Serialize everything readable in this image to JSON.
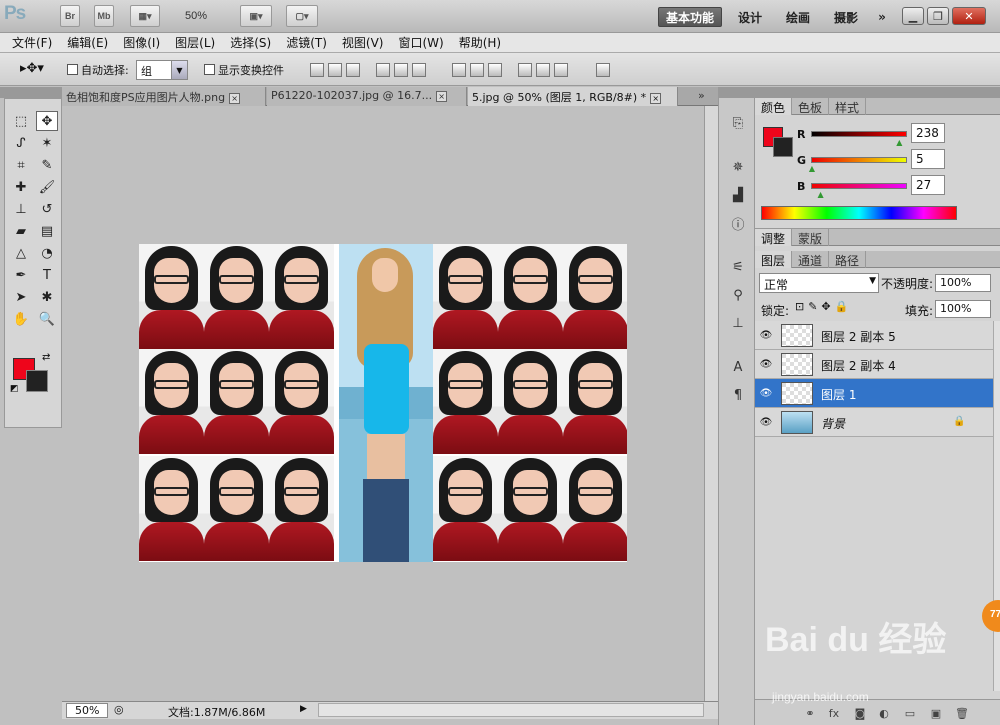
{
  "app": {
    "logo": "Ps",
    "br": "Br",
    "mb": "Mb",
    "zoom": "50%"
  },
  "workspaces": [
    "基本功能",
    "设计",
    "绘画",
    "摄影",
    "»"
  ],
  "menu": [
    "文件(F)",
    "编辑(E)",
    "图像(I)",
    "图层(L)",
    "选择(S)",
    "滤镜(T)",
    "视图(V)",
    "窗口(W)",
    "帮助(H)"
  ],
  "options": {
    "auto_select": "自动选择:",
    "group_value": "组",
    "show_transform": "显示变换控件"
  },
  "tabs": [
    {
      "label": "色相饱和度PS应用图片人物.png",
      "close": "×"
    },
    {
      "label": "P61220-102037.jpg @ 16.7...",
      "close": "×"
    },
    {
      "label": "5.jpg @ 50% (图层 1, RGB/8#) *",
      "close": "×"
    }
  ],
  "status": {
    "zoom": "50%",
    "doc": "文档:1.87M/6.86M"
  },
  "color_panel": {
    "tabs": [
      "颜色",
      "色板",
      "样式"
    ],
    "r_label": "R",
    "g_label": "G",
    "b_label": "B",
    "r": "238",
    "g": "5",
    "b": "27",
    "r_frac": 0.93,
    "g_frac": 0.02,
    "b_frac": 0.11
  },
  "adjust_tabs": [
    "调整",
    "蒙版"
  ],
  "layers_panel": {
    "tabs": [
      "图层",
      "通道",
      "路径"
    ],
    "blend_mode": "正常",
    "opacity_label": "不透明度:",
    "opacity": "100%",
    "lock_label": "锁定:",
    "fill_label": "填充:",
    "fill": "100%",
    "layers": [
      {
        "name": "图层 2 副本 5",
        "selected": false
      },
      {
        "name": "图层 2 副本 4",
        "selected": false
      },
      {
        "name": "图层 1",
        "selected": true
      },
      {
        "name": "背景",
        "selected": false
      }
    ]
  },
  "watermark": {
    "main": "Bai du 经验",
    "sub": "jingyan.baidu.com",
    "badge": "77"
  },
  "colors": {
    "foreground": "#ee051b",
    "background": "#222222",
    "selection": "#3274c9"
  }
}
